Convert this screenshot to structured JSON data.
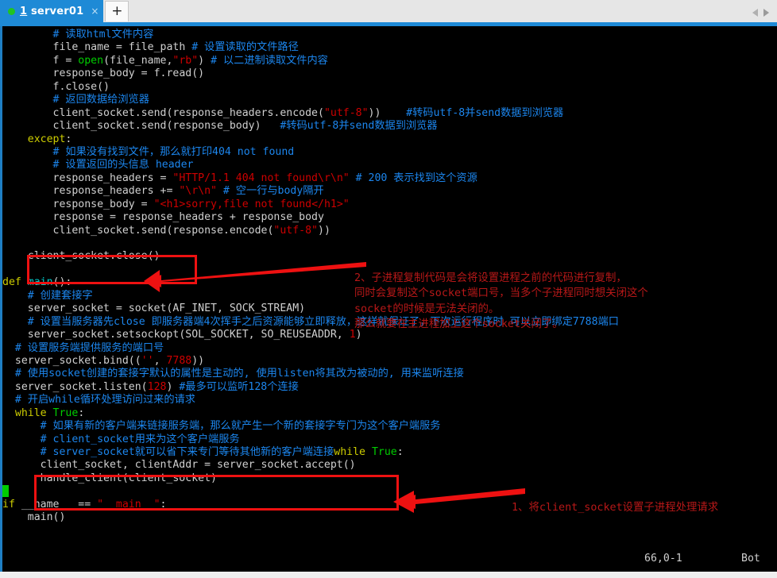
{
  "window": {
    "tab": {
      "index": "1",
      "title": "server01",
      "close_label": "×",
      "dot_color": "#21c421",
      "tab_color": "#1e8ad6"
    },
    "new_tab_label": "+",
    "nav_prev_icon": "chevron-left-icon",
    "nav_next_icon": "chevron-right-icon"
  },
  "editor": {
    "lines": [
      {
        "indent": 8,
        "segments": [
          {
            "t": "# 读取html文件内容",
            "c": "cm"
          }
        ]
      },
      {
        "indent": 8,
        "segments": [
          {
            "t": "file_name = file_path ",
            "c": "tx"
          },
          {
            "t": "# 设置读取的文件路径",
            "c": "cm"
          }
        ]
      },
      {
        "indent": 8,
        "segments": [
          {
            "t": "f = ",
            "c": "tx"
          },
          {
            "t": "open",
            "c": "bi"
          },
          {
            "t": "(file_name,",
            "c": "tx"
          },
          {
            "t": "\"rb\"",
            "c": "st"
          },
          {
            "t": ") ",
            "c": "tx"
          },
          {
            "t": "# 以二进制读取文件内容",
            "c": "cm"
          }
        ]
      },
      {
        "indent": 8,
        "segments": [
          {
            "t": "response_body = f.read()",
            "c": "tx"
          }
        ]
      },
      {
        "indent": 8,
        "segments": [
          {
            "t": "f.close()",
            "c": "tx"
          }
        ]
      },
      {
        "indent": 8,
        "segments": [
          {
            "t": "# 返回数据给浏览器",
            "c": "cm"
          }
        ]
      },
      {
        "indent": 8,
        "segments": [
          {
            "t": "client_socket.send(response_headers.encode(",
            "c": "tx"
          },
          {
            "t": "\"utf-8\"",
            "c": "st"
          },
          {
            "t": "))    ",
            "c": "tx"
          },
          {
            "t": "#转码utf-8并send数据到浏览器",
            "c": "cm"
          }
        ]
      },
      {
        "indent": 8,
        "segments": [
          {
            "t": "client_socket.send(response_body)   ",
            "c": "tx"
          },
          {
            "t": "#转码utf-8并send数据到浏览器",
            "c": "cm"
          }
        ]
      },
      {
        "indent": 4,
        "segments": [
          {
            "t": "except",
            "c": "kw"
          },
          {
            "t": ":",
            "c": "tx"
          }
        ]
      },
      {
        "indent": 8,
        "segments": [
          {
            "t": "# 如果没有找到文件，那么就打印404 not found",
            "c": "cm"
          }
        ]
      },
      {
        "indent": 8,
        "segments": [
          {
            "t": "# 设置返回的头信息 header",
            "c": "cm"
          }
        ]
      },
      {
        "indent": 8,
        "segments": [
          {
            "t": "response_headers = ",
            "c": "tx"
          },
          {
            "t": "\"HTTP/1.1 404 not found\\r\\n\"",
            "c": "st"
          },
          {
            "t": " ",
            "c": "tx"
          },
          {
            "t": "# 200 表示找到这个资源",
            "c": "cm"
          }
        ]
      },
      {
        "indent": 8,
        "segments": [
          {
            "t": "response_headers += ",
            "c": "tx"
          },
          {
            "t": "\"\\r\\n\"",
            "c": "st"
          },
          {
            "t": " ",
            "c": "tx"
          },
          {
            "t": "# 空一行与body隔开",
            "c": "cm"
          }
        ]
      },
      {
        "indent": 8,
        "segments": [
          {
            "t": "response_body = ",
            "c": "tx"
          },
          {
            "t": "\"<h1>sorry,file not found</h1>\"",
            "c": "st"
          }
        ]
      },
      {
        "indent": 8,
        "segments": [
          {
            "t": "response = response_headers + response_body",
            "c": "tx"
          }
        ]
      },
      {
        "indent": 8,
        "segments": [
          {
            "t": "client_socket.send(response.encode(",
            "c": "tx"
          },
          {
            "t": "\"utf-8\"",
            "c": "st"
          },
          {
            "t": "))",
            "c": "tx"
          }
        ]
      },
      {
        "indent": 0,
        "segments": []
      },
      {
        "indent": 4,
        "segments": [
          {
            "t": "client_socket.close()",
            "c": "tx"
          }
        ]
      },
      {
        "indent": 0,
        "segments": []
      },
      {
        "indent": 0,
        "segments": [
          {
            "t": "def",
            "c": "kw"
          },
          {
            "t": " ",
            "c": "tx"
          },
          {
            "t": "main",
            "c": "fn"
          },
          {
            "t": "():",
            "c": "tx"
          }
        ]
      },
      {
        "indent": 4,
        "segments": [
          {
            "t": "# 创建套接字",
            "c": "cm"
          }
        ]
      },
      {
        "indent": 4,
        "segments": [
          {
            "t": "server_socket = socket(AF_INET, SOCK_STREAM)",
            "c": "tx"
          }
        ]
      },
      {
        "indent": 4,
        "segments": [
          {
            "t": "# 设置当服务器先close 即服务器端4次挥手之后资源能够立即释放，这样就保证了，下次运行程序时 可以立即绑定7788端口",
            "c": "cm"
          }
        ]
      },
      {
        "indent": 4,
        "segments": [
          {
            "t": "server_socket.setsockopt(SOL_SOCKET, SO_REUSEADDR, ",
            "c": "tx"
          },
          {
            "t": "1",
            "c": "nm"
          },
          {
            "t": ")",
            "c": "tx"
          }
        ]
      },
      {
        "indent": 2,
        "segments": [
          {
            "t": "# 设置服务端提供服务的端口号",
            "c": "cm"
          }
        ]
      },
      {
        "indent": 2,
        "segments": [
          {
            "t": "server_socket.bind((",
            "c": "tx"
          },
          {
            "t": "''",
            "c": "st"
          },
          {
            "t": ", ",
            "c": "tx"
          },
          {
            "t": "7788",
            "c": "nm"
          },
          {
            "t": "))",
            "c": "tx"
          }
        ]
      },
      {
        "indent": 2,
        "segments": [
          {
            "t": "# 使用socket创建的套接字默认的属性是主动的, 使用listen将其改为被动的, 用来监听连接",
            "c": "cm"
          }
        ]
      },
      {
        "indent": 2,
        "segments": [
          {
            "t": "server_socket.listen(",
            "c": "tx"
          },
          {
            "t": "128",
            "c": "nm"
          },
          {
            "t": ") ",
            "c": "tx"
          },
          {
            "t": "#最多可以监听128个连接",
            "c": "cm"
          }
        ]
      },
      {
        "indent": 2,
        "segments": [
          {
            "t": "# 开启while循环处理访问过来的请求",
            "c": "cm"
          }
        ]
      },
      {
        "indent": 2,
        "segments": [
          {
            "t": "while",
            "c": "kw"
          },
          {
            "t": " ",
            "c": "tx"
          },
          {
            "t": "True",
            "c": "bi"
          },
          {
            "t": ":",
            "c": "tx"
          }
        ]
      },
      {
        "indent": 6,
        "segments": [
          {
            "t": "# 如果有新的客户端来链接服务端，那么就产生一个新的套接字专门为这个客户端服务",
            "c": "cm"
          }
        ]
      },
      {
        "indent": 6,
        "segments": [
          {
            "t": "# client_socket用来为这个客户端服务",
            "c": "cm"
          }
        ]
      },
      {
        "indent": 6,
        "segments": [
          {
            "t": "# server_socket就可以省下来专门等待其他新的客户端连接",
            "c": "cm"
          },
          {
            "t": "while",
            "c": "kw"
          },
          {
            "t": " ",
            "c": "tx"
          },
          {
            "t": "True",
            "c": "bi"
          },
          {
            "t": ":",
            "c": "tx"
          }
        ]
      },
      {
        "indent": 6,
        "segments": [
          {
            "t": "client_socket, clientAddr = server_socket.accept()",
            "c": "tx"
          }
        ]
      },
      {
        "indent": 6,
        "segments": [
          {
            "t": "handle_client(client_socket)",
            "c": "tx"
          }
        ]
      },
      {
        "indent": 0,
        "segments": [
          {
            "t": " ",
            "c": "cur"
          }
        ]
      },
      {
        "indent": 0,
        "segments": [
          {
            "t": "if",
            "c": "kw"
          },
          {
            "t": " __name__ == ",
            "c": "tx"
          },
          {
            "t": "\"__main__\"",
            "c": "st"
          },
          {
            "t": ":",
            "c": "tx"
          }
        ]
      },
      {
        "indent": 4,
        "segments": [
          {
            "t": "main()",
            "c": "tx"
          }
        ]
      }
    ]
  },
  "annotations": [
    {
      "id": "annotation-2",
      "color": "#b81818",
      "lines": [
        "2、子进程复制代码是会将设置进程之前的代码进行复制，",
        "同时会复制这个socket端口号，当多个子进程同时想关闭这个",
        "socket的时候是无法关闭的。",
        "那么就要在主进程加上这个socket关闭了。"
      ]
    },
    {
      "id": "annotation-1",
      "color": "#b81818",
      "lines": [
        "1、将client_socket设置子进程处理请求"
      ]
    }
  ],
  "status_bar": {
    "position": "66,0-1",
    "scroll": "Bot"
  }
}
